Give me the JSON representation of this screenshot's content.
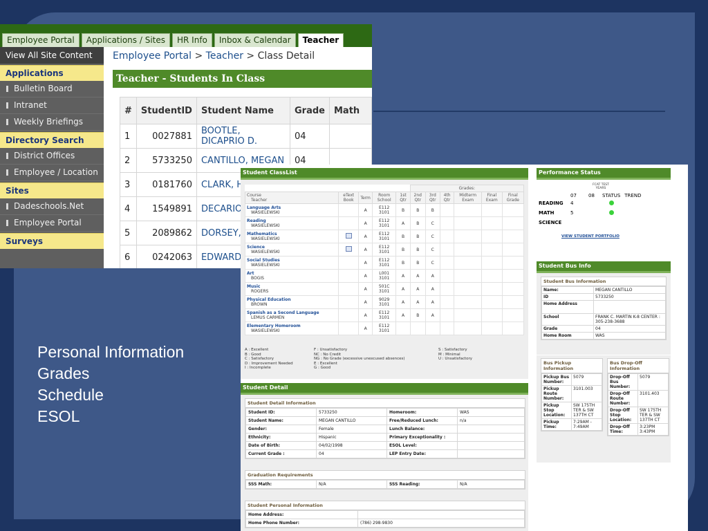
{
  "bullets": [
    "Personal Information",
    "Grades",
    "Schedule",
    "ESOL"
  ],
  "portal": {
    "tabs": [
      "Employee Portal",
      "Applications / Sites",
      "HR Info",
      "Inbox & Calendar",
      "Teacher"
    ],
    "view_all": "View All Site Content",
    "sections": [
      {
        "title": "Applications",
        "items": [
          "Bulletin Board",
          "Intranet",
          "Weekly Briefings"
        ]
      },
      {
        "title": "Directory Search",
        "items": [
          "District Offices",
          "Employee / Location"
        ]
      },
      {
        "title": "Sites",
        "items": [
          "Dadeschools.Net",
          "Employee Portal"
        ]
      },
      {
        "title": "Surveys",
        "items": []
      }
    ],
    "breadcrumb": {
      "a": "Employee Portal",
      "sep1": " > ",
      "b": "Teacher",
      "sep2": " > ",
      "c": "Class Detail"
    },
    "section_title": "Teacher - Students In Class",
    "table": {
      "headers": [
        "#",
        "StudentID",
        "Student Name",
        "Grade",
        "Math"
      ],
      "rows": [
        [
          "1",
          "0027881",
          "BOOTLE, DICAPRIO D.",
          "04"
        ],
        [
          "2",
          "5733250",
          "CANTILLO, MEGAN",
          "04"
        ],
        [
          "3",
          "0181760",
          "CLARK, HO",
          ""
        ],
        [
          "4",
          "1549891",
          "DECARIO,",
          ""
        ],
        [
          "5",
          "2089862",
          "DORSEY, I",
          ""
        ],
        [
          "6",
          "0242063",
          "EDWARD, I",
          ""
        ]
      ]
    }
  },
  "classlist": {
    "title": "Student ClassList",
    "grades_header": "Grades:",
    "headers": {
      "course": "Course",
      "teacher": "Teacher",
      "etext": "eText Book",
      "term": "Term",
      "room": "Room School",
      "q1": "1st Qtr",
      "q2": "2nd Qtr",
      "q3": "3rd Qtr",
      "q4": "4th Qtr",
      "midterm": "Midterm Exam",
      "final_exam": "Final Exam",
      "final_grade": "Final Grade"
    },
    "rows": [
      {
        "course": "Language Arts",
        "teacher": "WASIELEWSKI",
        "etext": "",
        "term": "A",
        "room": "E112",
        "school": "3101",
        "q1": "B",
        "q2": "B",
        "q3": "B"
      },
      {
        "course": "Reading",
        "teacher": "WASIELEWSKI",
        "etext": "",
        "term": "A",
        "room": "E112",
        "school": "3101",
        "q1": "A",
        "q2": "B",
        "q3": "C"
      },
      {
        "course": "Mathematics",
        "teacher": "WASIELEWSKI",
        "etext": "book",
        "term": "A",
        "room": "E112",
        "school": "3101",
        "q1": "B",
        "q2": "B",
        "q3": "C"
      },
      {
        "course": "Science",
        "teacher": "WASIELEWSKI",
        "etext": "book",
        "term": "A",
        "room": "E112",
        "school": "3101",
        "q1": "B",
        "q2": "B",
        "q3": "C"
      },
      {
        "course": "Social Studies",
        "teacher": "WASIELEWSKI",
        "etext": "",
        "term": "A",
        "room": "E112",
        "school": "3101",
        "q1": "B",
        "q2": "B",
        "q3": "C"
      },
      {
        "course": "Art",
        "teacher": "BOGIS",
        "etext": "",
        "term": "A",
        "room": "L001",
        "school": "3101",
        "q1": "A",
        "q2": "A",
        "q3": "A"
      },
      {
        "course": "Music",
        "teacher": "ROGERS",
        "etext": "",
        "term": "A",
        "room": "501C",
        "school": "3101",
        "q1": "A",
        "q2": "A",
        "q3": "A"
      },
      {
        "course": "Physical Education",
        "teacher": "BROWN",
        "etext": "",
        "term": "A",
        "room": "9029",
        "school": "3101",
        "q1": "A",
        "q2": "A",
        "q3": "A"
      },
      {
        "course": "Spanish as a Second Language",
        "teacher": "LEMUS CARMEN",
        "etext": "",
        "term": "A",
        "room": "E112",
        "school": "3101",
        "q1": "A",
        "q2": "B",
        "q3": "A"
      },
      {
        "course": "Elementary Homeroom",
        "teacher": "WASIELEWSKI",
        "etext": "",
        "term": "A",
        "room": "E112",
        "school": "3101",
        "q1": "",
        "q2": "",
        "q3": ""
      }
    ],
    "legend": {
      "col1": [
        "A : Excellent",
        "B : Good",
        "C : Satisfactory",
        "D : Improvement Needed",
        "I : Incomplete"
      ],
      "col2": [
        "F : Unsatisfactory",
        "NC : No Credit",
        "NG : No Grade (excessive unexcused absences)",
        "E : Excellent",
        "G : Good"
      ],
      "col3": [
        "S : Satisfactory",
        "M : Minimal",
        "U : Unsatisfactory"
      ]
    }
  },
  "perf": {
    "title": "Performance Status",
    "fcat": "FCAT TEST YEARS",
    "cols": [
      "07",
      "08",
      "STATUS",
      "TREND"
    ],
    "rows": [
      {
        "subject": "READING",
        "y07": "4",
        "dot": true
      },
      {
        "subject": "MATH",
        "y07": "5",
        "dot": true
      },
      {
        "subject": "SCIENCE",
        "y07": "",
        "dot": false
      }
    ],
    "link": "VIEW STUDENT PORTFOLIO"
  },
  "bus": {
    "title": "Student Bus Info",
    "sub": "Student Bus Information",
    "rows": [
      [
        "Name:",
        "MEGAN CANTILLO"
      ],
      [
        "ID",
        "5733250"
      ],
      [
        "Home Address",
        ""
      ],
      [
        "School",
        "FRANK C. MARTIN K-8 CENTER : 305-238-3688"
      ],
      [
        "Grade",
        "04"
      ],
      [
        "Home Room",
        "WAS"
      ]
    ],
    "pickup": {
      "title": "Bus Pickup Information",
      "rows": [
        [
          "Pickup Bus Number:",
          "5079"
        ],
        [
          "Pickup Route Number:",
          "3101.003"
        ],
        [
          "Pickup Stop Location:",
          "SW 175TH TER & SW 137TH CT"
        ],
        [
          "Pickup Time:",
          "7:29AM - 7:49AM"
        ]
      ]
    },
    "dropoff": {
      "title": "Bus Drop-Off Information",
      "rows": [
        [
          "Drop-Off Bus Number:",
          "5079"
        ],
        [
          "Drop-Off Route Number:",
          "3101.403"
        ],
        [
          "Drop-Off Stop Location:",
          "SW 175TH TER & SW 137TH CT"
        ],
        [
          "Drop-Off Time:",
          "3:23PM 3:43PM"
        ]
      ]
    }
  },
  "detail": {
    "title": "Student Detail",
    "sub": "Student Detail Information",
    "rows": [
      [
        "Student ID:",
        "5733250",
        "Homeroom:",
        "WAS"
      ],
      [
        "Student Name:",
        "MEGAN CANTILLO",
        "Free/Reduced Lunch:",
        "n/a"
      ],
      [
        "Gender:",
        "Female",
        "Lunch Balance:",
        ""
      ],
      [
        "Ethnicity:",
        "Hispanic",
        "Primary Exceptionality :",
        ""
      ],
      [
        "Date of Birth:",
        "04/02/1998",
        "ESOL Level:",
        ""
      ],
      [
        "Current Grade :",
        "04",
        "LEP Entry Date:",
        ""
      ]
    ],
    "grad_sub": "Graduation Requirements",
    "grad_row": [
      "SSS Math:",
      "N/A",
      "SSS Reading:",
      "N/A"
    ],
    "personal_sub": "Student Personal Information",
    "personal_rows": [
      [
        "Home Address:",
        ""
      ],
      [
        "Home Phone Number:",
        "(786) 298-9830"
      ]
    ]
  }
}
